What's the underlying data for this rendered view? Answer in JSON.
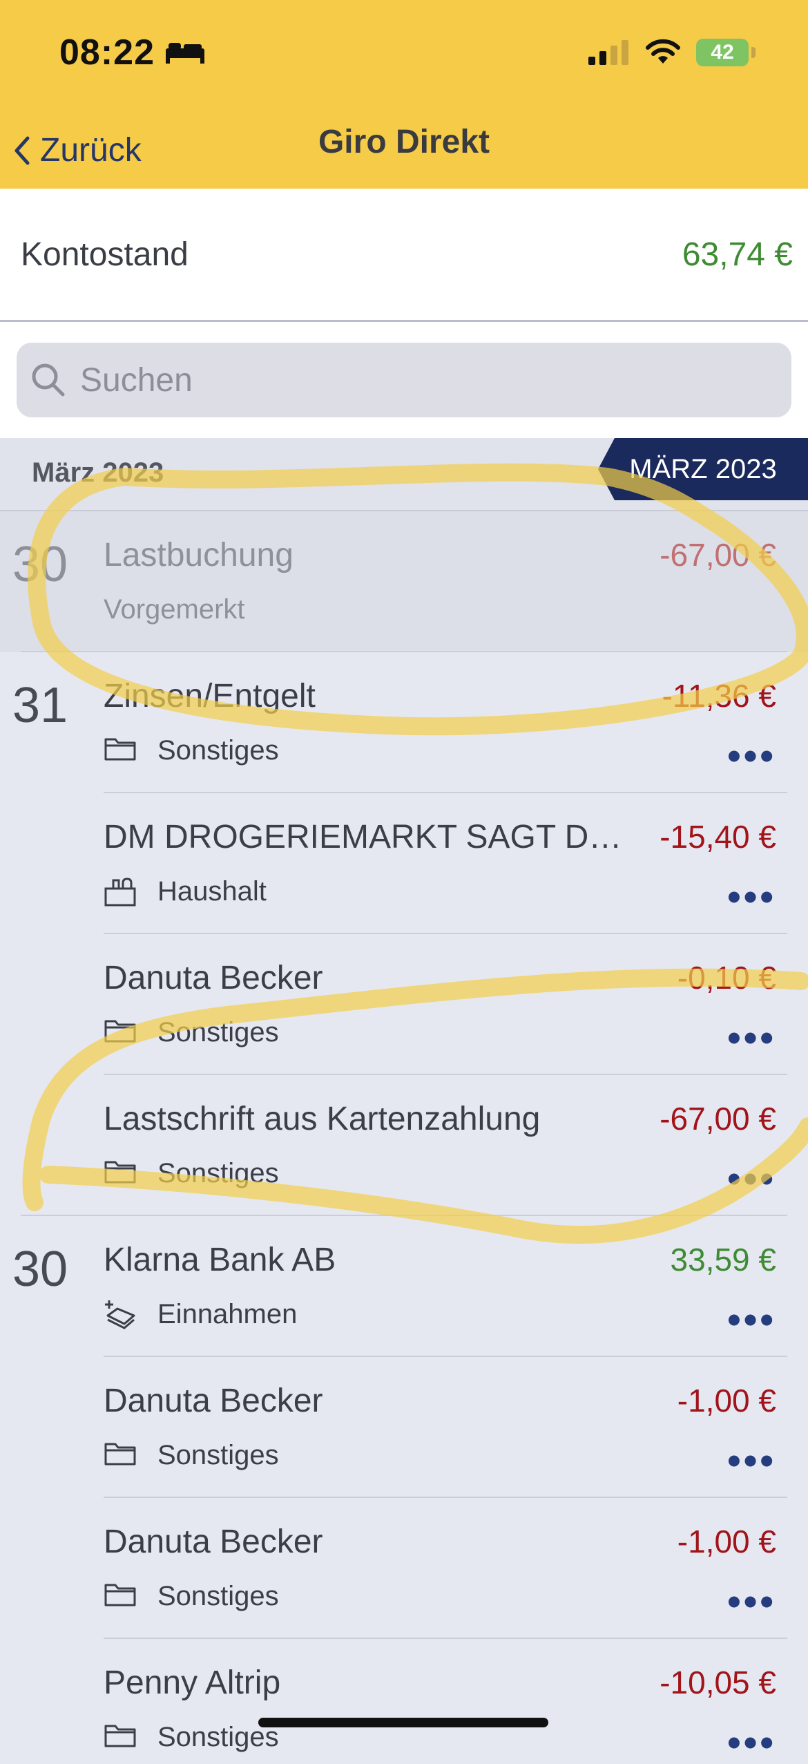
{
  "status_bar": {
    "time": "08:22",
    "battery": "42"
  },
  "nav": {
    "back_label": "Zurück",
    "title": "Giro Direkt"
  },
  "balance": {
    "label": "Kontostand",
    "value": "63,74 €"
  },
  "search": {
    "placeholder": "Suchen"
  },
  "month": {
    "label": "März 2023",
    "badge": "MÄRZ 2023"
  },
  "transactions": [
    {
      "day": "30",
      "payee": "Lastbuchung",
      "status": "Vorgemerkt",
      "amount": "-67,00 €",
      "pending": true
    },
    {
      "day": "31",
      "payee": "Zinsen/Entgelt",
      "category": "Sonstiges",
      "icon": "folder-icon",
      "amount": "-11,36 €"
    },
    {
      "day": "",
      "payee": "DM DROGERIEMARKT SAGT DA...",
      "category": "Haushalt",
      "icon": "household-icon",
      "amount": "-15,40 €"
    },
    {
      "day": "",
      "payee": "Danuta Becker",
      "category": "Sonstiges",
      "icon": "folder-icon",
      "amount": "-0,10 €"
    },
    {
      "day": "",
      "payee": "Lastschrift aus Kartenzahlung",
      "category": "Sonstiges",
      "icon": "folder-icon",
      "amount": "-67,00 €"
    },
    {
      "day": "30",
      "payee": "Klarna Bank AB",
      "category": "Einnahmen",
      "icon": "income-icon",
      "amount": "33,59 €"
    },
    {
      "day": "",
      "payee": "Danuta Becker",
      "category": "Sonstiges",
      "icon": "folder-icon",
      "amount": "-1,00 €"
    },
    {
      "day": "",
      "payee": "Danuta Becker",
      "category": "Sonstiges",
      "icon": "folder-icon",
      "amount": "-1,00 €"
    },
    {
      "day": "",
      "payee": "Penny Altrip",
      "category": "Sonstiges",
      "icon": "folder-icon",
      "amount": "-10,05 €"
    }
  ],
  "more_label": "•••",
  "colors": {
    "header": "#f5cb48",
    "negative": "#a0141a",
    "positive": "#3f8b34",
    "accent": "#1b2a5c"
  }
}
